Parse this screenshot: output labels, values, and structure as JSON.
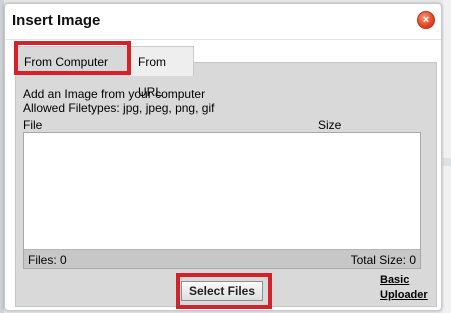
{
  "dialog": {
    "title": "Insert Image",
    "close_symbol": "×"
  },
  "tabs": [
    {
      "label": "From Computer",
      "active": true
    },
    {
      "label": "From URL",
      "active": false
    }
  ],
  "panel": {
    "line1": "Add an Image from your computer",
    "line2": "Allowed Filetypes: jpg, jpeg, png, gif",
    "columns": {
      "file": "File",
      "size": "Size"
    },
    "files_count": "Files: 0",
    "total_size": "Total Size: 0"
  },
  "buttons": {
    "select_files": "Select Files",
    "basic_uploader_line1": "Basic",
    "basic_uploader_line2": "Uploader"
  },
  "colors": {
    "highlight": "#d3212d",
    "close_button": "#e2431f"
  },
  "icons": {
    "close": "close-icon"
  }
}
